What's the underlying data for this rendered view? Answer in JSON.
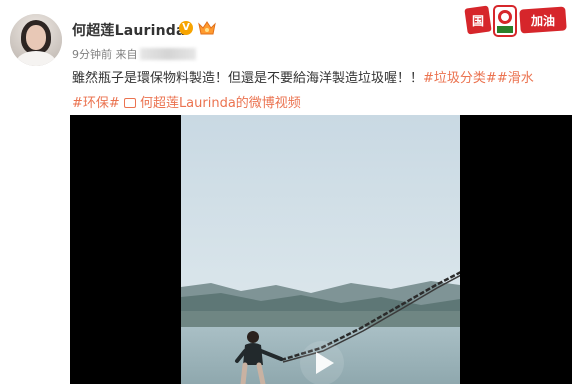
{
  "post": {
    "username": "何超莲Laurinda",
    "verified_badge": "V",
    "time": "9分钟前 来自",
    "text_main": "雖然瓶子是環保物料製造！但還是不要給海洋製造垃圾喔！！",
    "tags": [
      "#垃圾分类#",
      "#滑水",
      "#环保#"
    ],
    "video_link": "何超莲Laurinda的微博视频"
  },
  "icons": {
    "verified": "verified-v-icon",
    "member": "member-crown-icon",
    "video": "video-camera-icon",
    "play": "play-icon"
  },
  "promo": {
    "text": "国足加油"
  },
  "colors": {
    "link": "#eb7350",
    "verified": "#f7a400",
    "promo_red": "#d6262b"
  }
}
